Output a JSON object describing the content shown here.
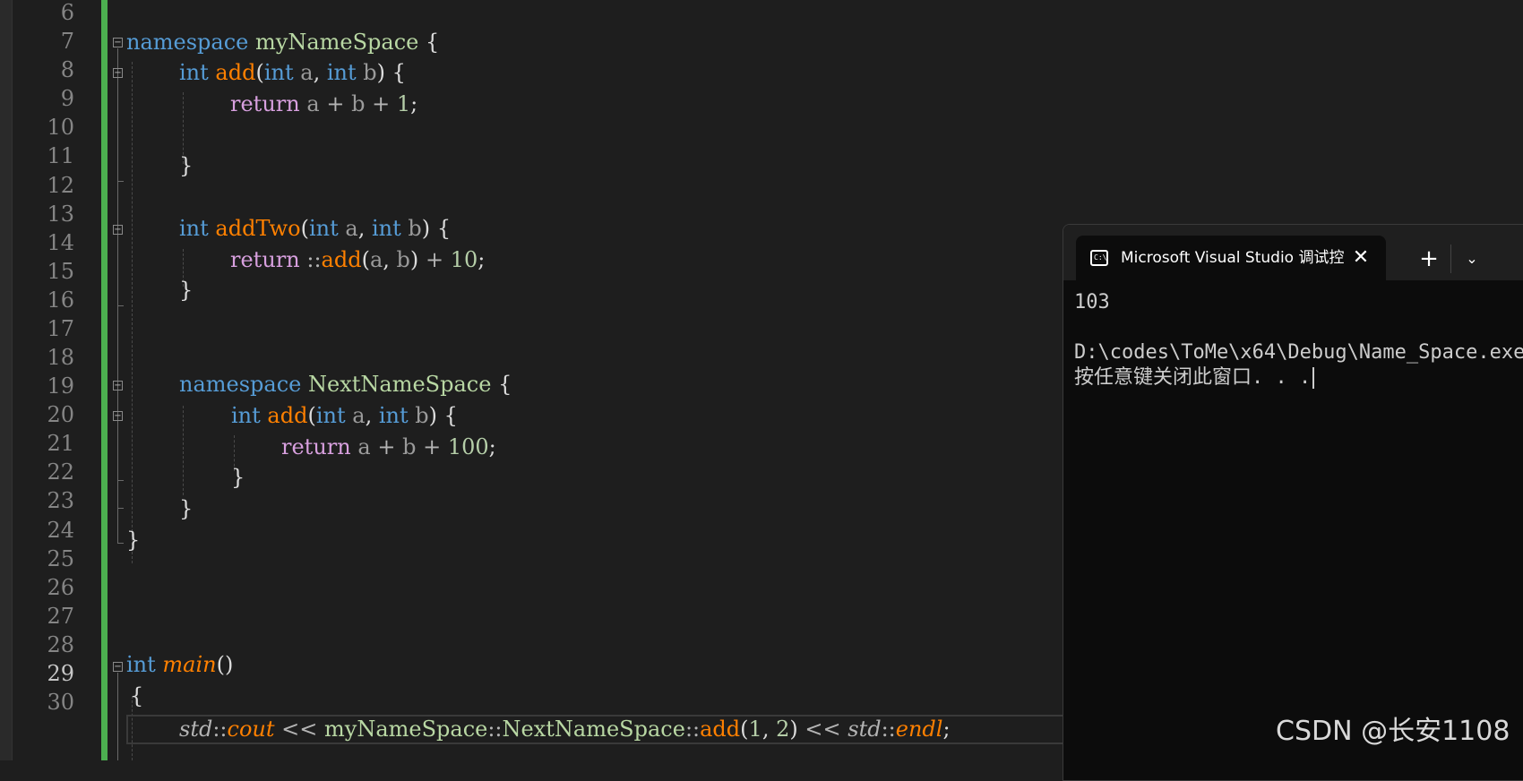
{
  "editor": {
    "line_numbers": [
      "6",
      "7",
      "8",
      "9",
      "10",
      "11",
      "12",
      "13",
      "14",
      "15",
      "16",
      "17",
      "18",
      "19",
      "20",
      "21",
      "22",
      "23",
      "24",
      "25",
      "26",
      "27",
      "28",
      "29",
      "30"
    ],
    "current_line": "29",
    "code": {
      "l7": {
        "kw": "namespace",
        "name": "myNameSpace",
        "brace": "{"
      },
      "l8": {
        "type": "int",
        "fn": "add",
        "open": "(",
        "t1": "int",
        "p1": "a",
        "comma": ",",
        "t2": "int",
        "p2": "b",
        "close": ")",
        "brace": "{"
      },
      "l9": {
        "ret": "return",
        "a": "a",
        "plus1": "+",
        "b": "b",
        "plus2": "+",
        "num": "1",
        "semi": ";"
      },
      "l11": {
        "brace": "}"
      },
      "l13": {
        "type": "int",
        "fn": "addTwo",
        "open": "(",
        "t1": "int",
        "p1": "a",
        "comma": ",",
        "t2": "int",
        "p2": "b",
        "close": ")",
        "brace": "{"
      },
      "l14": {
        "ret": "return",
        "scope": "::",
        "fn": "add",
        "open": "(",
        "a": "a",
        "comma": ",",
        "b": "b",
        "close": ")",
        "plus": "+",
        "num": "10",
        "semi": ";"
      },
      "l15": {
        "brace": "}"
      },
      "l18": {
        "kw": "namespace",
        "name": "NextNameSpace",
        "brace": "{"
      },
      "l19": {
        "type": "int",
        "fn": "add",
        "open": "(",
        "t1": "int",
        "p1": "a",
        "comma": ",",
        "t2": "int",
        "p2": "b",
        "close": ")",
        "brace": "{"
      },
      "l20": {
        "ret": "return",
        "a": "a",
        "plus1": "+",
        "b": "b",
        "plus2": "+",
        "num": "100",
        "semi": ";"
      },
      "l21": {
        "brace": "}"
      },
      "l22": {
        "brace": "}"
      },
      "l23": {
        "brace": "}"
      },
      "l27": {
        "type": "int",
        "fn": "main",
        "parens": "()"
      },
      "l28": {
        "brace": "{"
      },
      "l29": {
        "std1": "std",
        "scope1": "::",
        "cout": "cout",
        "op1": "<<",
        "ns1": "myNameSpace",
        "scope2": "::",
        "ns2": "NextNameSpace",
        "scope3": "::",
        "fn": "add",
        "open": "(",
        "n1": "1",
        "comma": ",",
        "n2": "2",
        "close": ")",
        "op2": "<<",
        "std2": "std",
        "scope4": "::",
        "endl": "endl",
        "semi": ";"
      }
    },
    "colors": {
      "background": "#1e1e1e",
      "keyword": "#569cd6",
      "control_keyword": "#d8a0df",
      "function": "#ff8000",
      "namespace": "#b8d7a3",
      "number": "#b5cea8",
      "change_bar": "#4caf50"
    }
  },
  "console": {
    "tab_title": "Microsoft Visual Studio 调试控制台",
    "tab_icon": "console-app-icon",
    "tab_icon_label": "C:\\",
    "close_glyph": "✕",
    "new_tab_glyph": "+",
    "dropdown_glyph": "⌄",
    "output": [
      "103",
      "",
      "D:\\codes\\ToMe\\x64\\Debug\\Name_Space.exe",
      "按任意键关闭此窗口. . ."
    ],
    "background": "#0c0c0c"
  },
  "watermark": "CSDN @长安1108"
}
